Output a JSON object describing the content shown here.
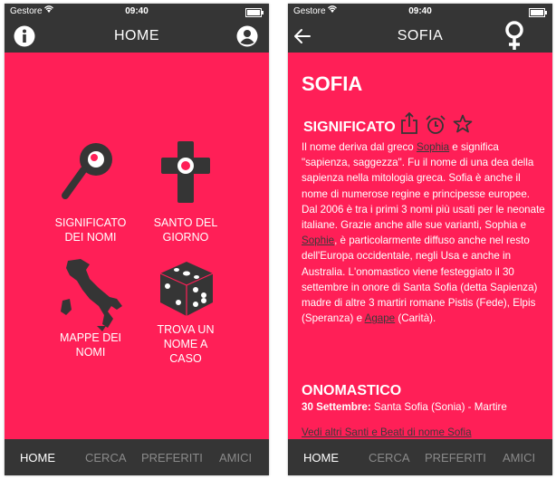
{
  "status_bar": {
    "carrier": "Gestore",
    "time": "09:40"
  },
  "home": {
    "title": "HOME",
    "items": [
      {
        "label": "SIGNIFICATO\nDEI NOMI"
      },
      {
        "label": "SANTO DEL\nGIORNO"
      },
      {
        "label": "MAPPE DEI\nNOMI"
      },
      {
        "label": "TROVA UN\nNOME A\nCASO"
      }
    ]
  },
  "detail": {
    "nav_title": "SOFIA",
    "name": "SOFIA",
    "section_title": "SIGNIFICATO",
    "body_parts": [
      "Il nome deriva dal greco ",
      "Sophia",
      " e significa \"sapienza, saggezza\". Fu il nome di una dea della sapienza nella mitologia greca. Sofia è anche il nome di numerose regine e principesse europee. Dal 2006 è tra i primi 3 nomi più usati per le neonate italiane. Grazie anche alle sue varianti, Sophia e ",
      "Sophie",
      ", è particolarmente diffuso anche nel resto dell'Europa occidentale, negli Usa e anche in Australia. L'onomastico viene festeggiato il 30 settembre in onore di Santa Sofia (detta Sapienza) madre di altre 3 martiri romane Pistis (Fede), Elpis (Speranza) e ",
      "Agape",
      " (Carità)."
    ],
    "onomastico_title": "ONOMASTICO",
    "onomastico_date": "30 Settembre:",
    "onomastico_text": " Santa Sofia (Sonia) - Martire",
    "more_link": "Vedi altri Santi e Beati di nome Sofia"
  },
  "tabs": [
    "HOME",
    "CERCA",
    "PREFERITI",
    "AMICI"
  ],
  "colors": {
    "background": "#ff1f57",
    "bar": "#353535",
    "inactive_tab": "#8a8a8a",
    "link": "#3a3a3a"
  }
}
